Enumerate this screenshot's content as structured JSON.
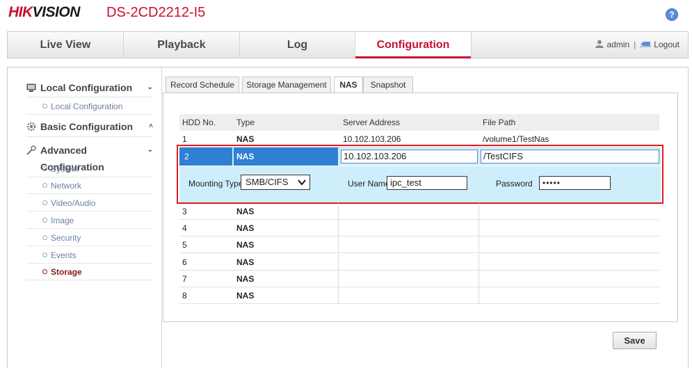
{
  "header": {
    "logo_hik": "HIK",
    "logo_vision": "VISION",
    "model": "DS-2CD2212-I5",
    "help_label": "?"
  },
  "nav": {
    "tabs": [
      {
        "label": "Live View"
      },
      {
        "label": "Playback"
      },
      {
        "label": "Log"
      },
      {
        "label": "Configuration",
        "active": true
      }
    ],
    "user": "admin",
    "separator": "|",
    "logout": "Logout"
  },
  "sidebar": {
    "sections": [
      {
        "label": "Local Configuration",
        "chevron": "⌄",
        "icon": "monitor-icon"
      },
      {
        "label": "Basic Configuration",
        "chevron": "˄",
        "icon": "gear-icon"
      },
      {
        "label": "Advanced Configuration",
        "chevron": "⌄",
        "icon": "wrench-icon"
      }
    ],
    "local_items": [
      "Local Configuration"
    ],
    "advanced_items": [
      "System",
      "Network",
      "Video/Audio",
      "Image",
      "Security",
      "Events",
      "Storage"
    ],
    "active_item": "Storage"
  },
  "subtabs": [
    {
      "label": "Record Schedule"
    },
    {
      "label": "Storage Management"
    },
    {
      "label": "NAS",
      "active": true
    },
    {
      "label": "Snapshot"
    }
  ],
  "table": {
    "headers": [
      "HDD No.",
      "Type",
      "Server Address",
      "File Path"
    ],
    "rows": [
      {
        "hdd": "1",
        "type": "NAS",
        "server": "10.102.103.206",
        "path": "/volume1/TestNas"
      },
      {
        "hdd": "2",
        "type": "NAS",
        "server": "10.102.103.206",
        "path": "/TestCIFS"
      },
      {
        "hdd": "3",
        "type": "NAS",
        "server": "",
        "path": ""
      },
      {
        "hdd": "4",
        "type": "NAS",
        "server": "",
        "path": ""
      },
      {
        "hdd": "5",
        "type": "NAS",
        "server": "",
        "path": ""
      },
      {
        "hdd": "6",
        "type": "NAS",
        "server": "",
        "path": ""
      },
      {
        "hdd": "7",
        "type": "NAS",
        "server": "",
        "path": ""
      },
      {
        "hdd": "8",
        "type": "NAS",
        "server": "",
        "path": ""
      }
    ]
  },
  "mount": {
    "type_label": "Mounting Type",
    "type_value": "SMB/CIFS",
    "user_label": "User Name",
    "user_value": "ipc_test",
    "password_label": "Password",
    "password_value": "•••••"
  },
  "save_label": "Save",
  "colors": {
    "brand_red": "#c8102e",
    "selection_blue": "#2f7fd3",
    "row_highlight": "#cfeefb",
    "highlight_border": "#e0191e"
  }
}
